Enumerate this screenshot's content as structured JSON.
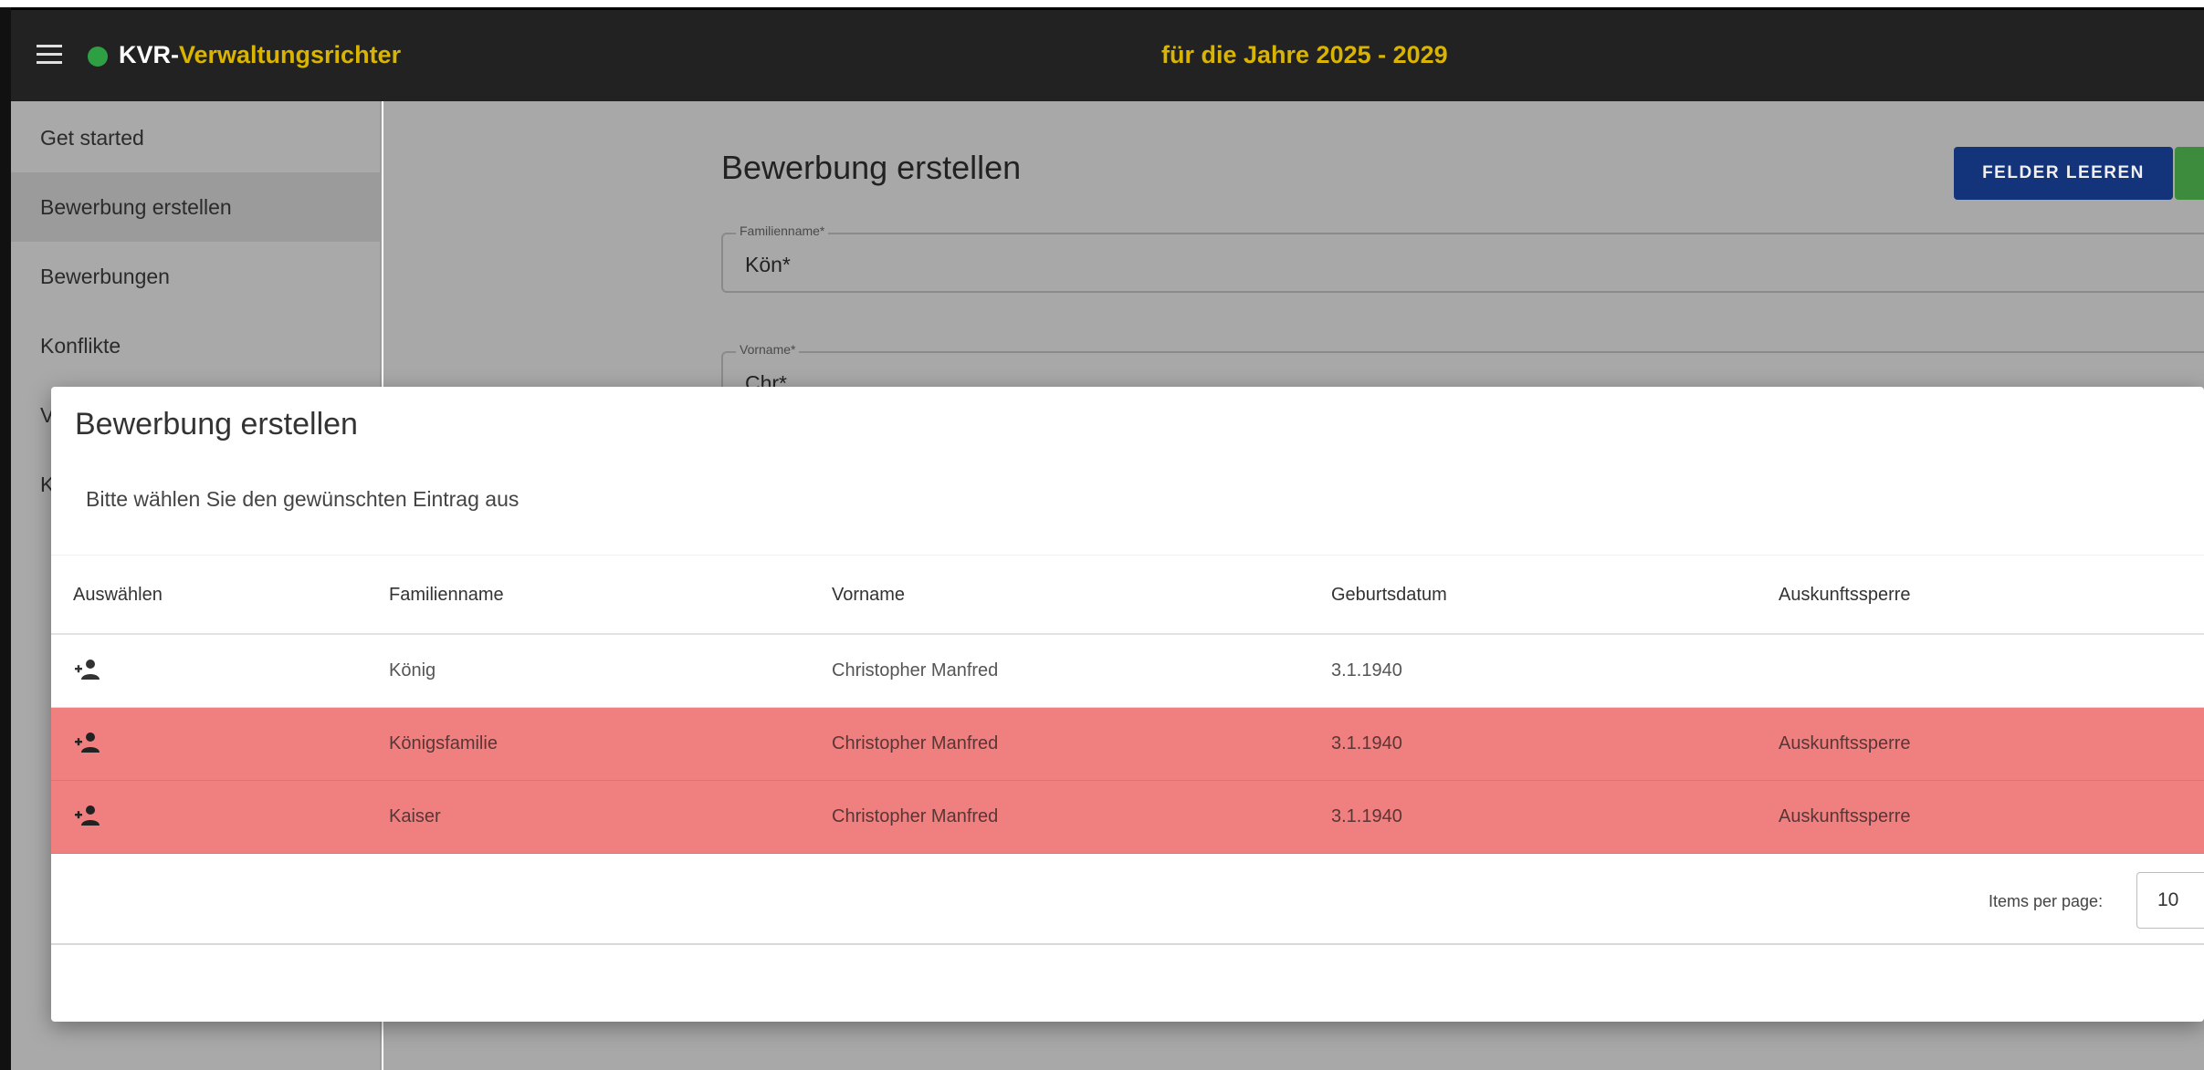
{
  "app": {
    "title_part1": "KVR-",
    "title_part2": "Verwaltungsrichter",
    "subtitle": "für die Jahre 2025 - 2029",
    "status_color": "#2ea043",
    "accent_color": "#d9b400"
  },
  "sidebar": {
    "items": [
      {
        "label": "Get started"
      },
      {
        "label": "Bewerbung erstellen",
        "active": true
      },
      {
        "label": "Bewerbungen"
      },
      {
        "label": "Konflikte"
      },
      {
        "label": "V"
      },
      {
        "label": "K"
      }
    ]
  },
  "background_form": {
    "heading": "Bewerbung erstellen",
    "clear_button": "FELDER LEEREN",
    "fields": [
      {
        "label": "Familienname*",
        "value": "Kön*"
      },
      {
        "label": "Vorname*",
        "value": "Chr*"
      }
    ]
  },
  "dialog": {
    "title": "Bewerbung erstellen",
    "text": "Bitte wählen Sie den gewünschten Eintrag aus",
    "columns": [
      "Auswählen",
      "Familienname",
      "Vorname",
      "Geburtsdatum",
      "Auskunftssperre"
    ],
    "rows": [
      {
        "icon": "person-add-icon",
        "familienname": "König",
        "vorname": "Christopher Manfred",
        "geburtsdatum": "3.1.1940",
        "auskunftssperre": ""
      },
      {
        "icon": "person-add-icon",
        "familienname": "Königsfamilie",
        "vorname": "Christopher Manfred",
        "geburtsdatum": "3.1.1940",
        "auskunftssperre": "Auskunftssperre"
      },
      {
        "icon": "person-add-icon",
        "familienname": "Kaiser",
        "vorname": "Christopher Manfred",
        "geburtsdatum": "3.1.1940",
        "auskunftssperre": "Auskunftssperre"
      }
    ],
    "blocked_row_color": "#f08080",
    "pagination": {
      "items_per_page_label": "Items per page:",
      "items_per_page_value": "10"
    }
  }
}
